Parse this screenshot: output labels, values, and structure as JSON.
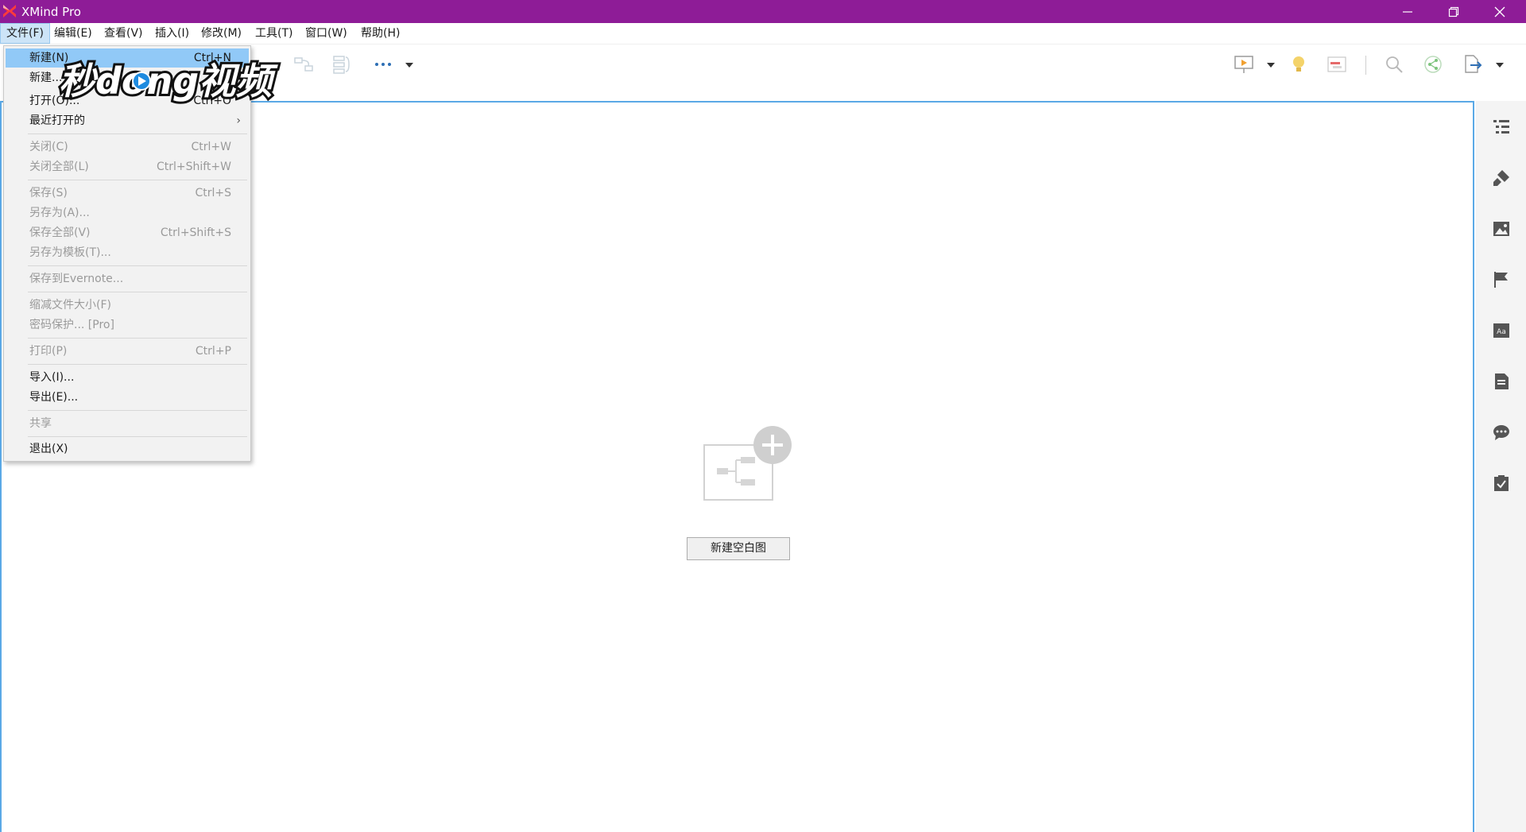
{
  "window": {
    "title": "XMind Pro",
    "title_bar_color": "#8e1c97",
    "controls": [
      "minimize-icon",
      "restore-icon",
      "close-icon"
    ]
  },
  "menubar": {
    "items": [
      {
        "label": "文件(F)",
        "active": true
      },
      {
        "label": "编辑(E)"
      },
      {
        "label": "查看(V)"
      },
      {
        "label": "插入(I)"
      },
      {
        "label": "修改(M)"
      },
      {
        "label": "工具(T)"
      },
      {
        "label": "窗口(W)"
      },
      {
        "label": "帮助(H)"
      }
    ]
  },
  "file_menu": {
    "items": [
      {
        "label": "新建(N)",
        "shortcut": "Ctrl+N",
        "enabled": true,
        "highlighted": true
      },
      {
        "label": "新建...",
        "shortcut": "",
        "enabled": true
      },
      {
        "label": "打开(O)...",
        "shortcut": "Ctrl+O",
        "enabled": true
      },
      {
        "label": "最近打开的",
        "shortcut": "",
        "enabled": true,
        "submenu": true
      },
      {
        "label": "关闭(C)",
        "shortcut": "Ctrl+W",
        "enabled": false
      },
      {
        "label": "关闭全部(L)",
        "shortcut": "Ctrl+Shift+W",
        "enabled": false
      },
      {
        "label": "保存(S)",
        "shortcut": "Ctrl+S",
        "enabled": false
      },
      {
        "label": "另存为(A)...",
        "shortcut": "",
        "enabled": false
      },
      {
        "label": "保存全部(V)",
        "shortcut": "Ctrl+Shift+S",
        "enabled": false
      },
      {
        "label": "另存为模板(T)...",
        "shortcut": "",
        "enabled": false
      },
      {
        "label": "保存到Evernote...",
        "shortcut": "",
        "enabled": false
      },
      {
        "label": "缩减文件大小(F)",
        "shortcut": "",
        "enabled": false
      },
      {
        "label": "密码保护... [Pro]",
        "shortcut": "",
        "enabled": false
      },
      {
        "label": "打印(P)",
        "shortcut": "Ctrl+P",
        "enabled": false
      },
      {
        "label": "导入(I)...",
        "shortcut": "",
        "enabled": true
      },
      {
        "label": "导出(E)...",
        "shortcut": "",
        "enabled": true
      },
      {
        "label": "共享",
        "shortcut": "",
        "enabled": false
      },
      {
        "label": "退出(X)",
        "shortcut": "",
        "enabled": true
      }
    ],
    "submenu_arrow": "›"
  },
  "toolbar": {
    "icons": [
      "relationship-icon",
      "summary-icon",
      "more-icon",
      "dropdown-arrow-icon",
      "presentation-icon",
      "dropdown-arrow-icon",
      "brainstorm-bulb-icon",
      "gantt-icon",
      "search-icon",
      "share-icon",
      "export-icon",
      "dropdown-arrow-icon"
    ]
  },
  "sidebar": {
    "icons": [
      "outline-icon",
      "format-brush-icon",
      "image-icon",
      "flag-marker-icon",
      "font-icon",
      "notes-icon",
      "comment-icon",
      "task-icon"
    ]
  },
  "canvas": {
    "new_blank_button": "新建空白图",
    "border_color": "#5aa9e6"
  },
  "watermark": {
    "text": "秒dong视频"
  }
}
